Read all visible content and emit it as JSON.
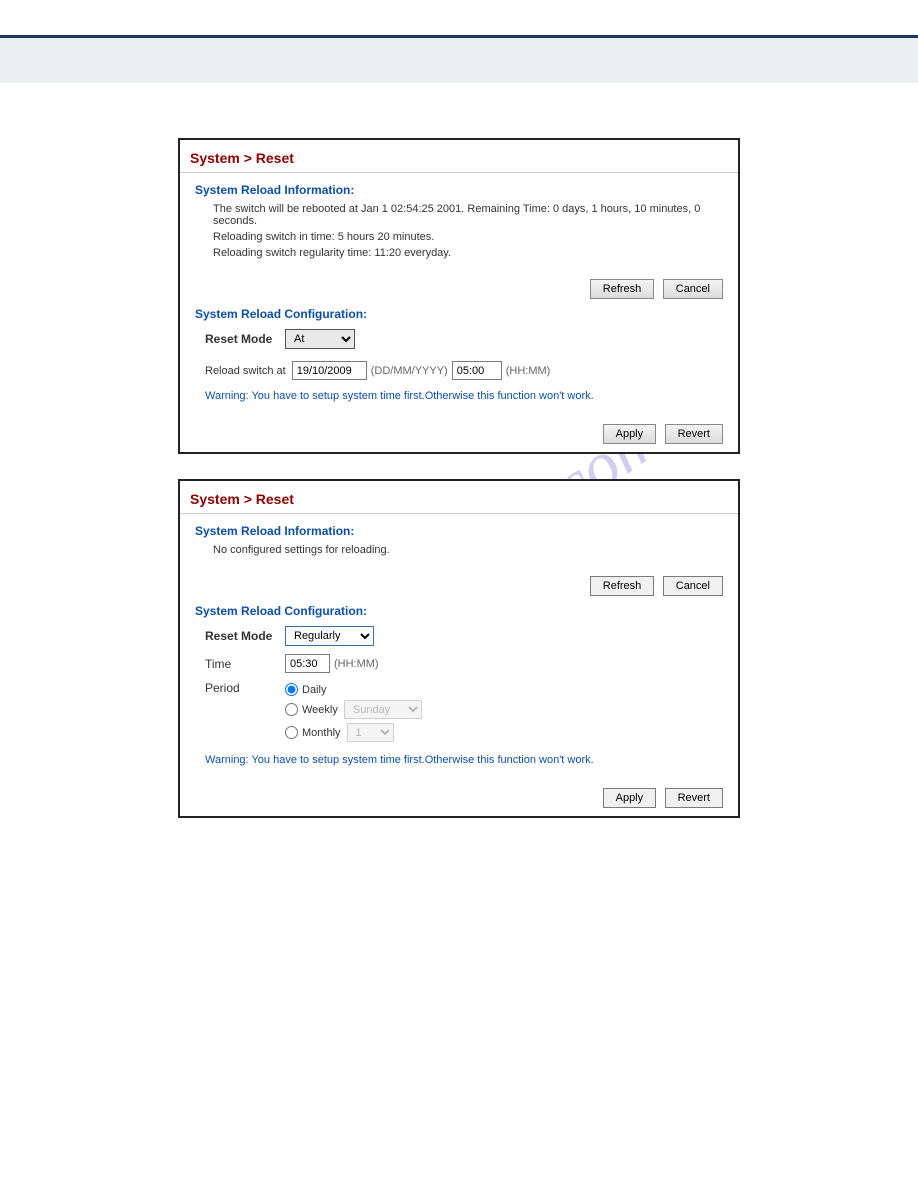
{
  "panel1": {
    "title": "System > Reset",
    "info_title": "System Reload Information:",
    "info_lines": [
      "The switch will be rebooted at Jan 1 02:54:25 2001. Remaining Time: 0 days, 1 hours, 10 minutes, 0 seconds.",
      "Reloading switch in time: 5 hours 20 minutes.",
      "Reloading switch regularity time: 11:20 everyday."
    ],
    "refresh_label": "Refresh",
    "cancel_label": "Cancel",
    "config_title": "System Reload Configuration:",
    "reset_mode_label": "Reset Mode",
    "reset_mode_value": "At",
    "reload_switch_label": "Reload switch at",
    "date_value": "19/10/2009",
    "date_hint": "(DD/MM/YYYY)",
    "time_value": "05:00",
    "time_hint": "(HH:MM)",
    "warning": "Warning: You have to setup system time first.Otherwise this function won't work.",
    "apply_label": "Apply",
    "revert_label": "Revert"
  },
  "panel2": {
    "title": "System > Reset",
    "info_title": "System Reload Information:",
    "info_line": "No configured settings for reloading.",
    "refresh_label": "Refresh",
    "cancel_label": "Cancel",
    "config_title": "System Reload Configuration:",
    "reset_mode_label": "Reset Mode",
    "reset_mode_value": "Regularly",
    "time_label": "Time",
    "time_value": "05:30",
    "time_hint": "(HH:MM)",
    "period_label": "Period",
    "daily_label": "Daily",
    "weekly_label": "Weekly",
    "weekly_day": "Sunday",
    "monthly_label": "Monthly",
    "monthly_day": "1",
    "warning": "Warning: You have to setup system time first.Otherwise this function won't work.",
    "apply_label": "Apply",
    "revert_label": "Revert"
  },
  "watermark": "manualshive.com"
}
